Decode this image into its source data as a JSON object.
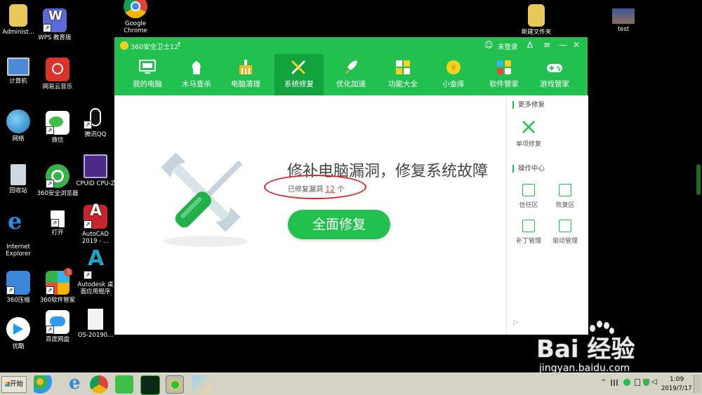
{
  "desktop": {
    "icons": [
      {
        "label": "Administ..."
      },
      {
        "label": "WPS 教育版"
      },
      {
        "label": "Google Chrome"
      },
      {
        "label": "新建文件夹"
      },
      {
        "label": "test"
      },
      {
        "label": "计算机"
      },
      {
        "label": "网易云音乐"
      },
      {
        "label": "网络"
      },
      {
        "label": "微信"
      },
      {
        "label": "腾讯QQ"
      },
      {
        "label": "回收站"
      },
      {
        "label": "360安全浏览器"
      },
      {
        "label": "CPUID CPU-Z"
      },
      {
        "label": "Internet Explorer"
      },
      {
        "label": "打开"
      },
      {
        "label": "AutoCAD 2019 - ..."
      },
      {
        "label": "360压缩"
      },
      {
        "label": "360软件管家"
      },
      {
        "label": "Autodesk 桌面应用程序"
      },
      {
        "label": "优酷"
      },
      {
        "label": "百度网盘"
      },
      {
        "label": "OS-20190..."
      }
    ],
    "badge_count": "3"
  },
  "window": {
    "title": "360安全卫士12",
    "login": "未登录",
    "nav": [
      {
        "label": "我的电脑"
      },
      {
        "label": "木马查杀"
      },
      {
        "label": "电脑清理"
      },
      {
        "label": "系统修复"
      },
      {
        "label": "优化加速"
      },
      {
        "label": "功能大全"
      },
      {
        "label": "小金库"
      },
      {
        "label": "软件管家"
      },
      {
        "label": "游戏管家"
      }
    ],
    "main": {
      "headline": "修补电脑漏洞，修复系统故障",
      "fixed_prefix": "已修复漏洞",
      "fixed_count": "12",
      "fixed_suffix": "个",
      "button": "全面修复"
    },
    "side": {
      "more_repair": "更多修复",
      "single_repair": "单项修复",
      "ops_center": "操作中心",
      "items": [
        {
          "label": "信任区"
        },
        {
          "label": "恢复区"
        },
        {
          "label": "补丁管理"
        },
        {
          "label": "驱动管理"
        }
      ]
    }
  },
  "taskbar": {
    "start": "开始",
    "time": "1:09",
    "date": "2019/7/17"
  },
  "watermark": {
    "logo": "Bai 经验",
    "url": "jingyan.baidu.com"
  },
  "colors": {
    "accent": "#22c04e",
    "accent_dark": "#13a33e",
    "highlight": "#e84a3a",
    "annotation": "#d8262b"
  }
}
